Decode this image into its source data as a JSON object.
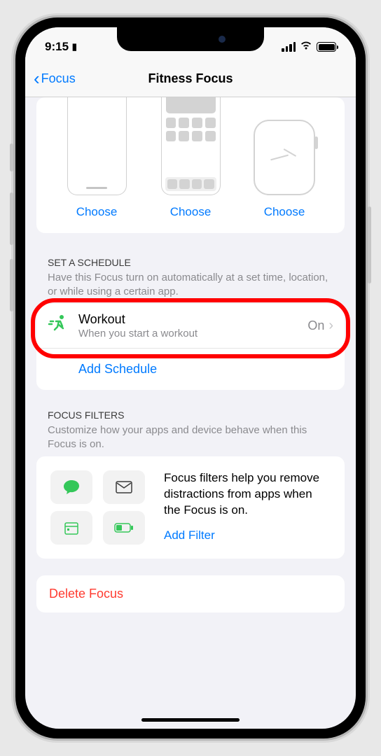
{
  "status": {
    "time": "9:15",
    "card_icon": "▯"
  },
  "nav": {
    "back_label": "Focus",
    "title": "Fitness Focus"
  },
  "devices": {
    "choose_label": "Choose"
  },
  "schedule": {
    "header": "SET A SCHEDULE",
    "description": "Have this Focus turn on automatically at a set time, location, or while using a certain app.",
    "workout": {
      "title": "Workout",
      "subtitle": "When you start a workout",
      "status": "On"
    },
    "add_label": "Add Schedule"
  },
  "filters": {
    "header": "FOCUS FILTERS",
    "description": "Customize how your apps and device behave when this Focus is on.",
    "help_text": "Focus filters help you remove distractions from apps when the Focus is on.",
    "add_label": "Add Filter"
  },
  "delete": {
    "label": "Delete Focus"
  }
}
